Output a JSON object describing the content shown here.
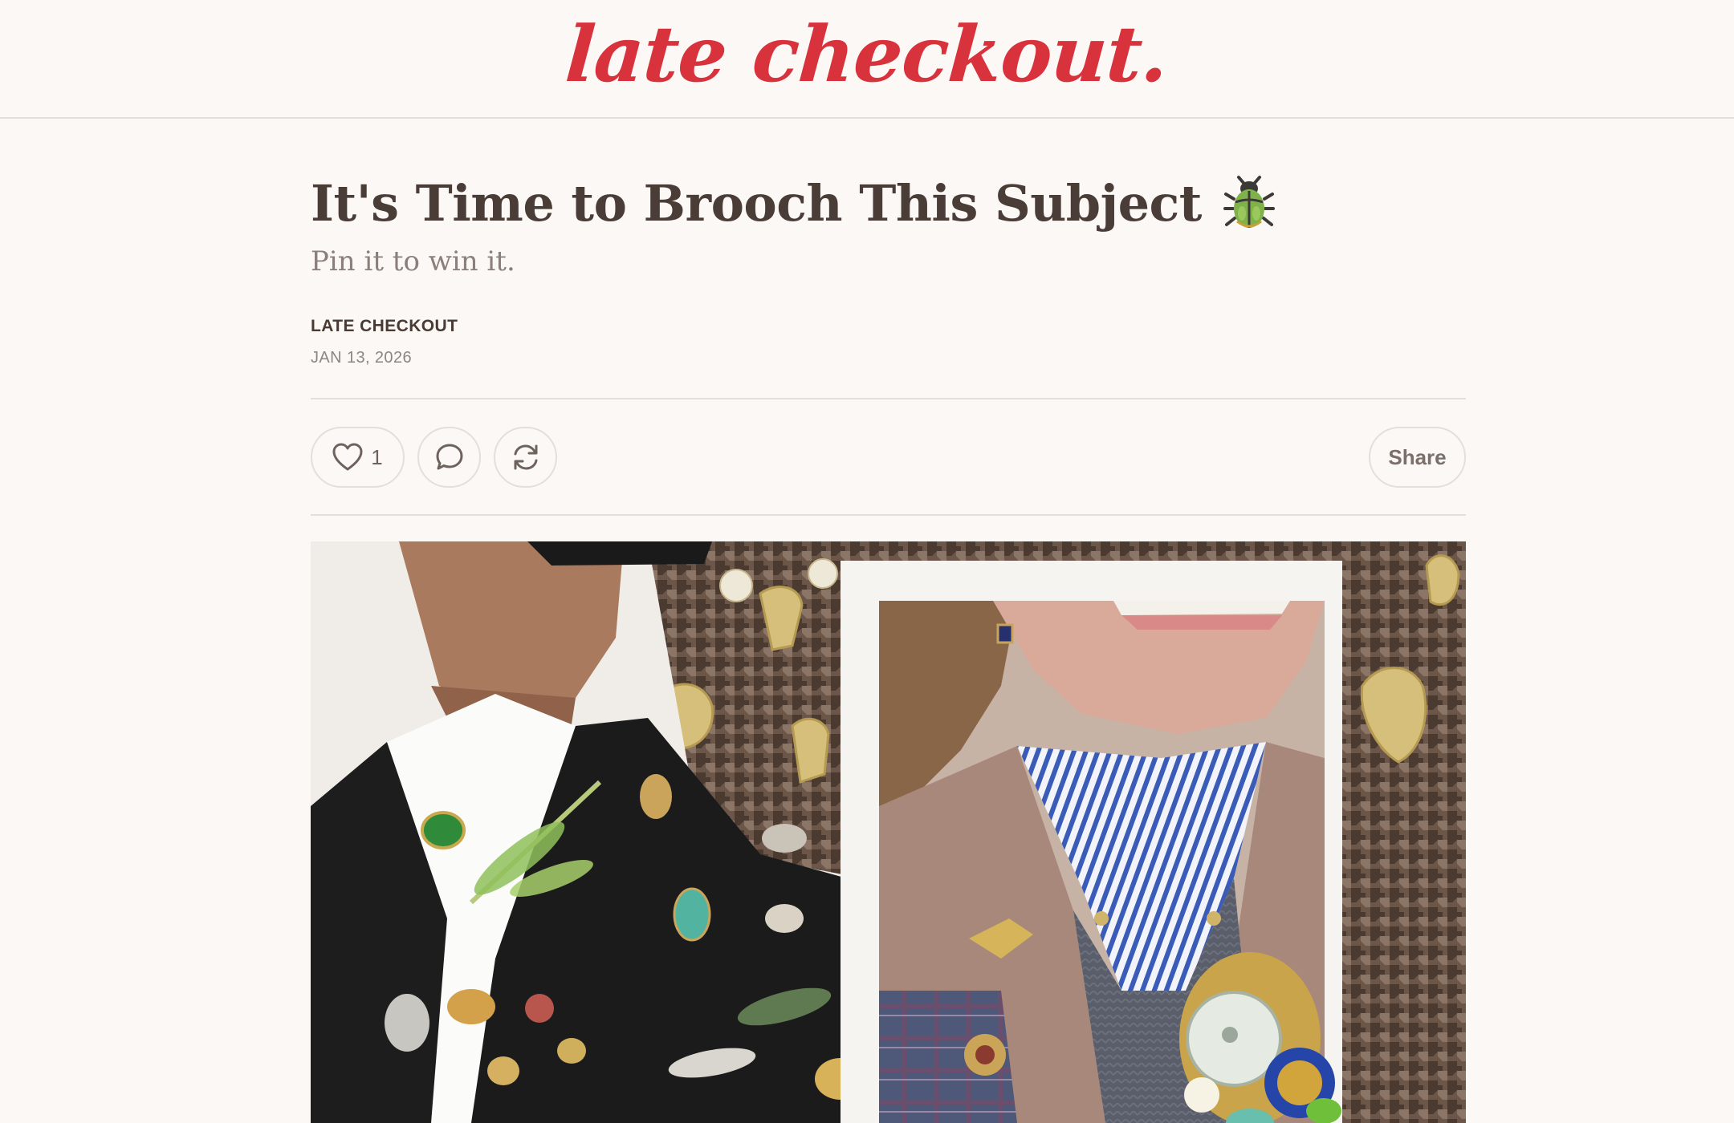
{
  "brand": {
    "logo_text": "late checkout.",
    "logo_color": "#d8323c"
  },
  "post": {
    "title": "It's Time to Brooch This Subject",
    "title_emoji": "beetle-icon",
    "subtitle": "Pin it to win it.",
    "author": "LATE CHECKOUT",
    "date": "JAN 13, 2026"
  },
  "actions": {
    "like_count": "1",
    "share_label": "Share",
    "icons": [
      "heart-icon",
      "comment-icon",
      "restack-icon"
    ]
  },
  "hero_image": {
    "left_panel": "man in black suit jacket with insect brooches",
    "right_panel": "woman in collared jacket with brooches inside white frame",
    "background": "houndstooth fabric with gold masks and bows"
  },
  "colors": {
    "background": "#fbf8f5",
    "divider": "#e3dfdb",
    "text": "#4a3a34",
    "muted": "#8a7f7a"
  }
}
